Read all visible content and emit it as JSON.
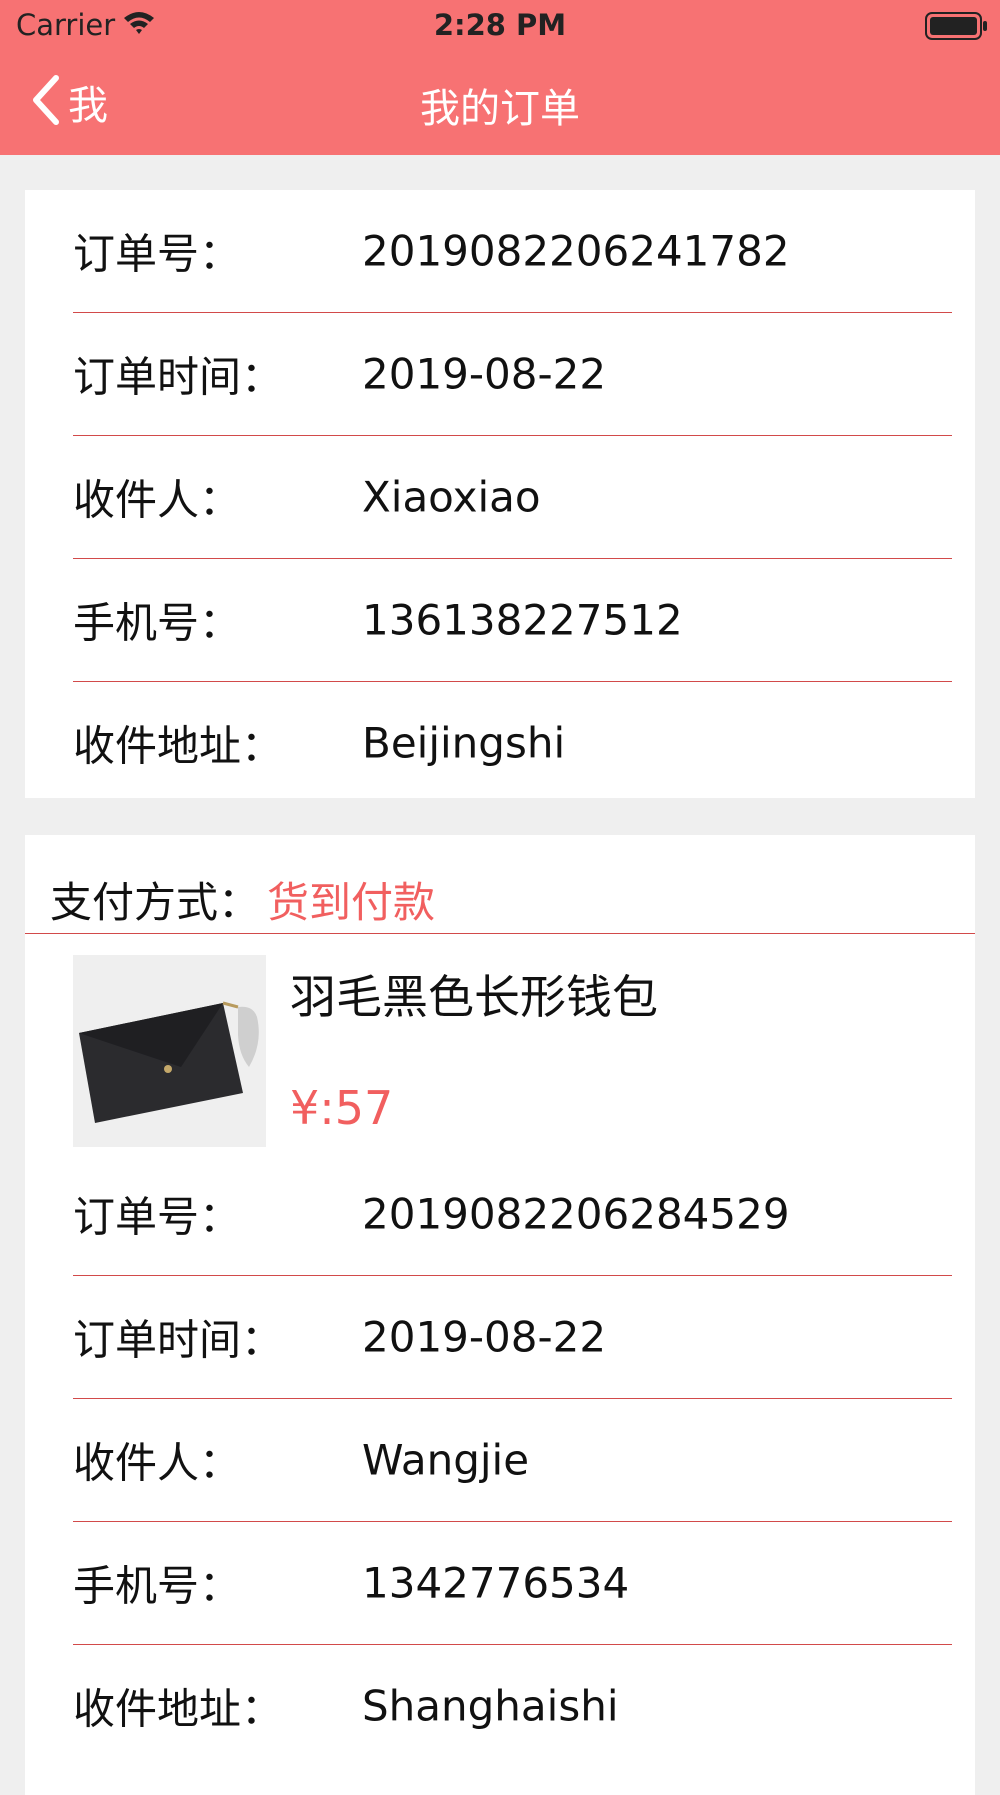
{
  "status_bar": {
    "carrier": "Carrier",
    "time": "2:28 PM"
  },
  "nav": {
    "back_label": "我",
    "title": "我的订单"
  },
  "orders": [
    {
      "rows": [
        {
          "label": "订单号：",
          "value": "2019082206241782"
        },
        {
          "label": "订单时间：",
          "value": "2019-08-22"
        },
        {
          "label": "收件人：",
          "value": "Xiaoxiao"
        },
        {
          "label": "手机号：",
          "value": "136138227512"
        },
        {
          "label": "收件地址：",
          "value": "Beijingshi"
        }
      ]
    },
    {
      "payment_label": "支付方式：",
      "payment_value": "货到付款",
      "product": {
        "name": "羽毛黑色长形钱包",
        "price": "¥:57"
      },
      "rows": [
        {
          "label": "订单号：",
          "value": "2019082206284529"
        },
        {
          "label": "订单时间：",
          "value": "2019-08-22"
        },
        {
          "label": "收件人：",
          "value": "Wangjie"
        },
        {
          "label": "手机号：",
          "value": "1342776534"
        },
        {
          "label": "收件地址：",
          "value": "Shanghaishi"
        }
      ]
    }
  ],
  "colors": {
    "header": "#f77273",
    "accent": "#f15f5f",
    "divider": "#d24a4a",
    "background": "#efefef"
  },
  "icons": [
    "wifi-icon",
    "battery-icon",
    "back-chevron-icon"
  ]
}
